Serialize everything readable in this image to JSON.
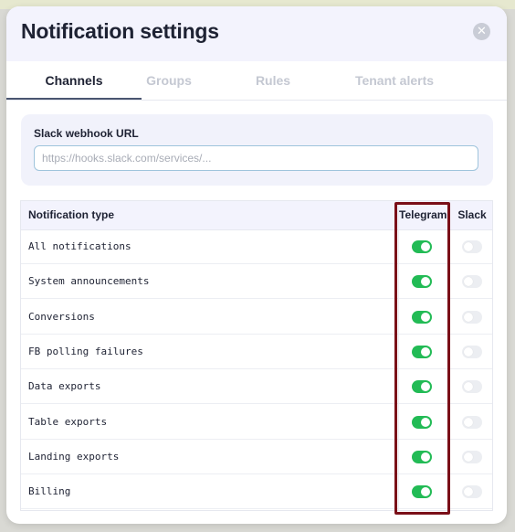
{
  "modal": {
    "title": "Notification settings",
    "close_icon": "close-icon"
  },
  "tabs": [
    {
      "label": "Channels",
      "active": true
    },
    {
      "label": "Groups",
      "active": false
    },
    {
      "label": "Rules",
      "active": false
    },
    {
      "label": "Tenant alerts",
      "active": false
    }
  ],
  "webhook": {
    "label": "Slack webhook URL",
    "placeholder": "https://hooks.slack.com/services/...",
    "value": ""
  },
  "table": {
    "headers": {
      "type": "Notification type",
      "telegram": "Telegram",
      "slack": "Slack"
    },
    "rows": [
      {
        "label": "All notifications",
        "telegram": true,
        "slack": false
      },
      {
        "label": "System announcements",
        "telegram": true,
        "slack": false
      },
      {
        "label": "Conversions",
        "telegram": true,
        "slack": false
      },
      {
        "label": "FB polling failures",
        "telegram": true,
        "slack": false
      },
      {
        "label": "Data exports",
        "telegram": true,
        "slack": false
      },
      {
        "label": "Table exports",
        "telegram": true,
        "slack": false
      },
      {
        "label": "Landing exports",
        "telegram": true,
        "slack": false
      },
      {
        "label": "Billing",
        "telegram": true,
        "slack": false
      }
    ]
  },
  "colors": {
    "toggle_on": "#22bb55",
    "toggle_off": "#eceef2",
    "highlight": "#7a0f18"
  }
}
